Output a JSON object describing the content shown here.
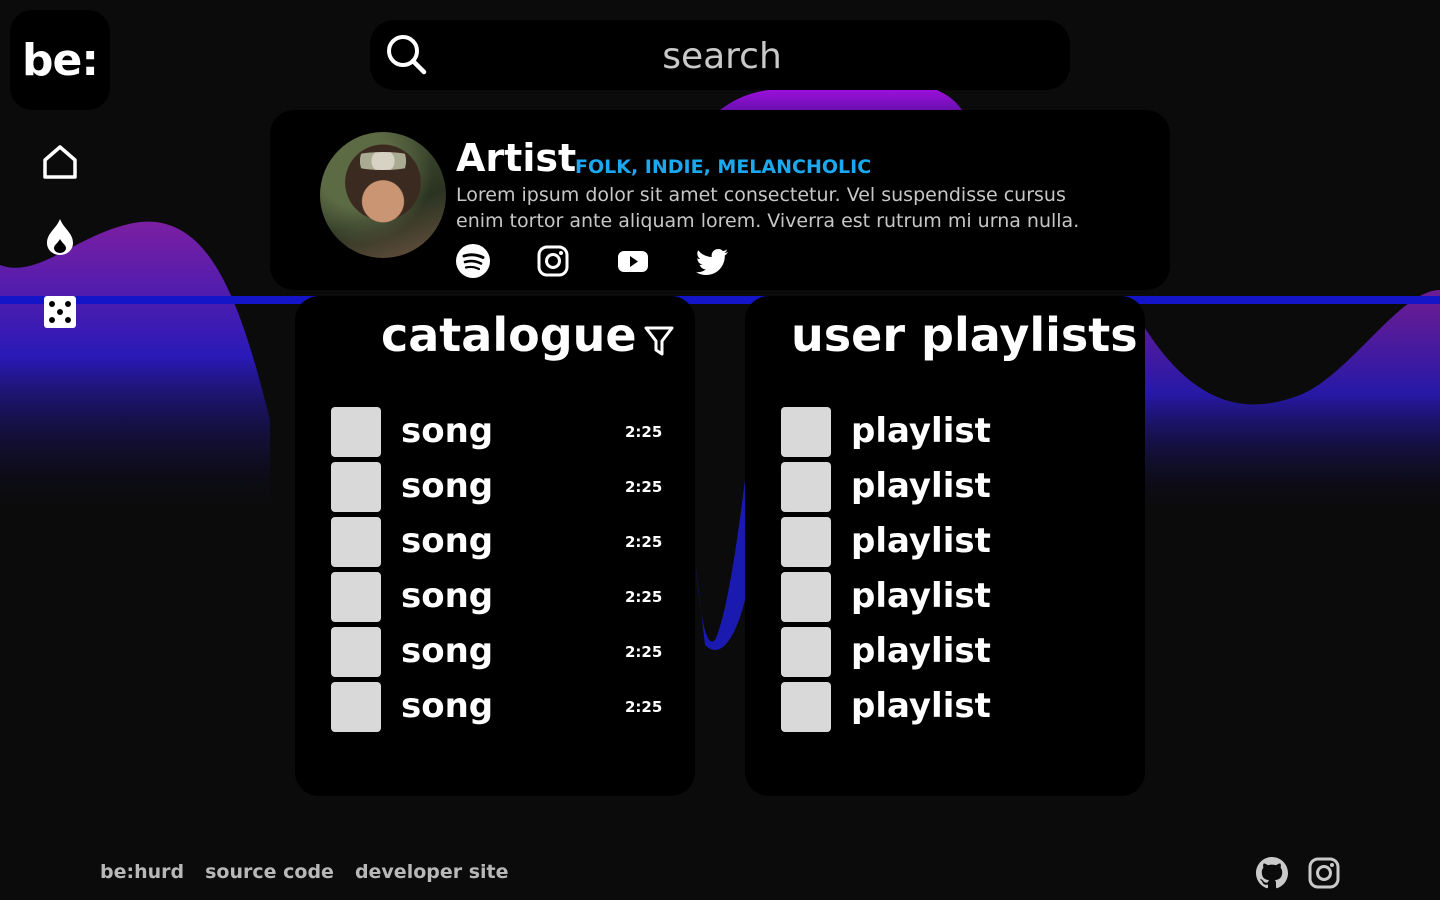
{
  "brand": {
    "logo_text": "be:"
  },
  "nav": [
    {
      "name": "home-icon"
    },
    {
      "name": "flame-icon"
    },
    {
      "name": "dice-icon"
    }
  ],
  "search": {
    "placeholder": "search"
  },
  "artist": {
    "name": "Artist",
    "tags": "FOLK, INDIE, MELANCHOLIC",
    "bio": "Lorem ipsum dolor sit amet consectetur. Vel suspendisse cursus enim tortor ante aliquam lorem. Viverra est rutrum mi urna nulla.",
    "socials": [
      "spotify-icon",
      "instagram-icon",
      "youtube-icon",
      "twitter-icon"
    ]
  },
  "catalogue": {
    "title": "catalogue",
    "songs": [
      {
        "title": "song",
        "duration": "2:25"
      },
      {
        "title": "song",
        "duration": "2:25"
      },
      {
        "title": "song",
        "duration": "2:25"
      },
      {
        "title": "song",
        "duration": "2:25"
      },
      {
        "title": "song",
        "duration": "2:25"
      },
      {
        "title": "song",
        "duration": "2:25"
      }
    ]
  },
  "playlists": {
    "title": "user playlists",
    "items": [
      {
        "title": "playlist"
      },
      {
        "title": "playlist"
      },
      {
        "title": "playlist"
      },
      {
        "title": "playlist"
      },
      {
        "title": "playlist"
      },
      {
        "title": "playlist"
      }
    ]
  },
  "footer": {
    "links": [
      "be:hurd",
      "source code",
      "developer site"
    ],
    "icons": [
      "github-icon",
      "instagram-icon"
    ]
  },
  "colors": {
    "accent_blue": "#1aa8f0",
    "thumb": "#d9d9d9",
    "wave_purple": "#7a1fa8",
    "wave_blue": "#1a1ab0"
  }
}
